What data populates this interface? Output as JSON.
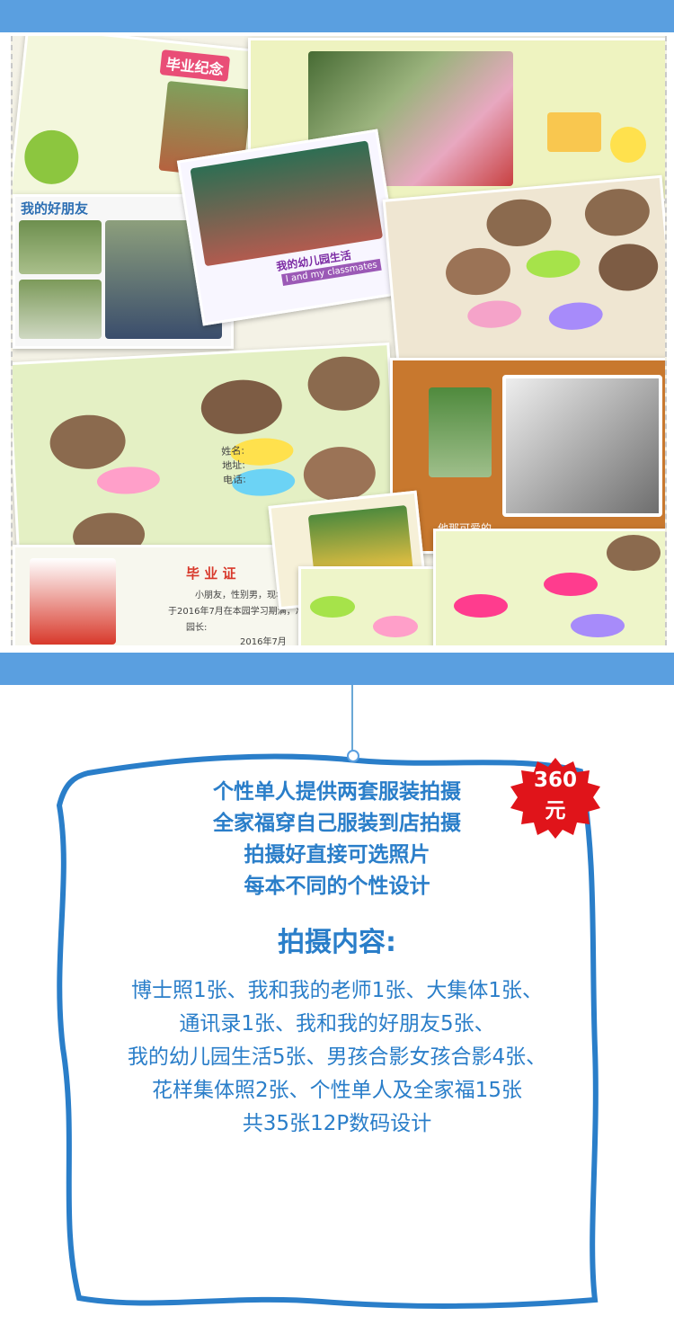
{
  "collage": {
    "memorial_tag": "毕业纪念",
    "friends_heading": "我的好朋友",
    "kindergarten_life": "我的幼儿园生活",
    "kindergarten_life_en": "I and my classmates",
    "cute_caption": "他那可爱的",
    "certificate_title": "毕 业 证",
    "certificate_line": "小朋友，性别男，现年",
    "certificate_line2": "于2016年7月在本园学习期满，准予",
    "certificate_principal": "园长:",
    "certificate_date": "2016年7月",
    "label_name": "姓名:",
    "label_address": "地址:",
    "label_phone": "电话:"
  },
  "info": {
    "lines": [
      "个性单人提供两套服装拍摄",
      "全家福穿自己服装到店拍摄",
      "拍摄好直接可选照片",
      "每本不同的个性设计"
    ]
  },
  "price": {
    "amount": "360",
    "unit": "元"
  },
  "content": {
    "title": "拍摄内容:",
    "lines": [
      "博士照1张、我和我的老师1张、大集体1张、",
      "通讯录1张、我和我的好朋友5张、",
      "我的幼儿园生活5张、男孩合影女孩合影4张、",
      "花样集体照2张、个性单人及全家福15张",
      "共35张12P数码设计"
    ]
  },
  "colors": {
    "accent": "#2a7ec9",
    "band": "#5a9fe0",
    "badge": "#e0141a"
  }
}
